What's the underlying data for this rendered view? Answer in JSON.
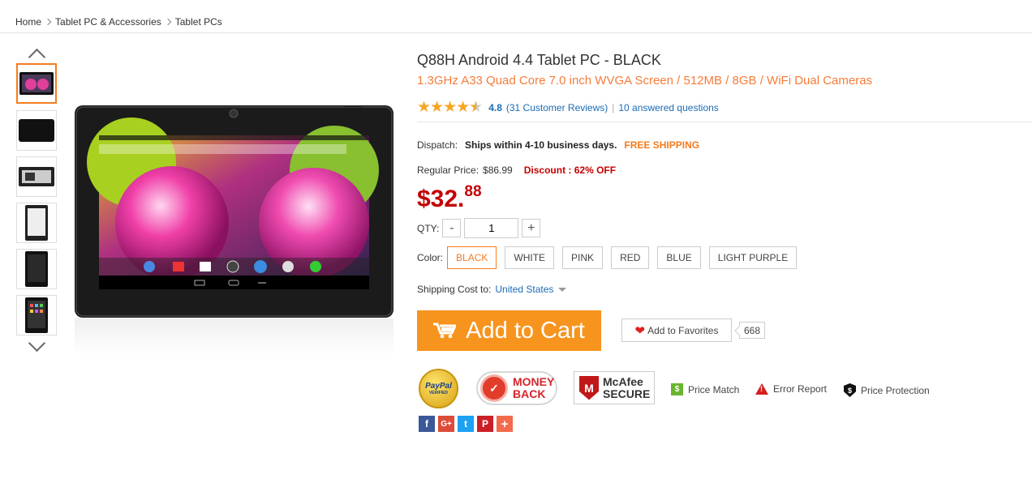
{
  "breadcrumb": [
    "Home",
    "Tablet PC & Accessories",
    "Tablet PCs"
  ],
  "product": {
    "title": "Q88H Android 4.4 Tablet PC  -  BLACK",
    "subtitle": "1.3GHz A33 Quad Core 7.0 inch WVGA Screen / 512MB / 8GB / WiFi Dual Cameras",
    "rating": {
      "stars": 4.5,
      "score": "4.8",
      "reviews": "(31 Customer Reviews)",
      "separator": "|",
      "questions": "10 answered questions"
    },
    "dispatch": {
      "label": "Dispatch:",
      "value": "Ships within 4-10 business days.",
      "free": "FREE SHIPPING"
    },
    "regular": {
      "label": "Regular Price:",
      "value": "$86.99",
      "discount": "Discount : 62% OFF"
    },
    "price": {
      "main": "$32.",
      "cents": "88"
    },
    "qty": {
      "label": "QTY:",
      "minus": "-",
      "value": "1",
      "plus": "+"
    },
    "color": {
      "label": "Color:",
      "options": [
        "BLACK",
        "WHITE",
        "PINK",
        "RED",
        "BLUE",
        "LIGHT PURPLE"
      ],
      "selected": "BLACK"
    },
    "shipping": {
      "label": "Shipping Cost to:",
      "country": "United States"
    },
    "cart_label": "Add to Cart",
    "favorites": {
      "label": "Add to Favorites",
      "count": "668"
    },
    "badges": {
      "paypal": "PayPal",
      "paypal_sub": "VERIFIED",
      "money": "MONEY",
      "back": "BACK",
      "mcafee": "McAfee",
      "secure": "SECURE"
    },
    "tools": [
      "Price Match",
      "Error Report",
      "Price Protection"
    ],
    "social": [
      {
        "icon": "facebook-icon",
        "glyph": "f",
        "color": "#3b5998"
      },
      {
        "icon": "google-plus-icon",
        "glyph": "G+",
        "color": "#dd4b39"
      },
      {
        "icon": "twitter-icon",
        "glyph": "t",
        "color": "#1da1f2"
      },
      {
        "icon": "pinterest-icon",
        "glyph": "P",
        "color": "#cb2027"
      },
      {
        "icon": "share-more-icon",
        "glyph": "+",
        "color": "#f26b4d"
      }
    ]
  },
  "colors": {
    "accent": "#f7941d",
    "price": "#c40000",
    "link": "#1a6bb5",
    "subtitle": "#f57c3a"
  }
}
